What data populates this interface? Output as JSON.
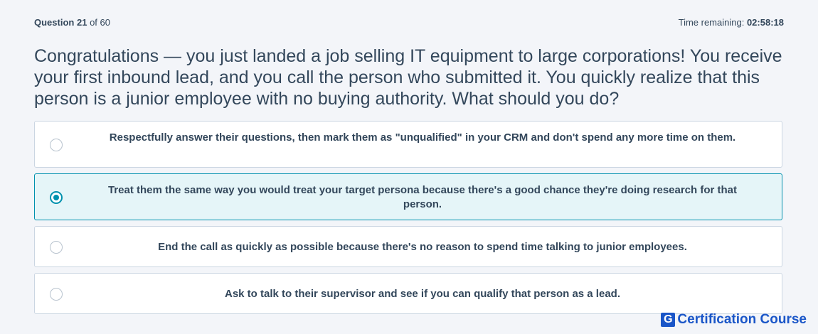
{
  "header": {
    "question_label": "Question",
    "question_number": "21",
    "question_of": "of 60",
    "time_label": "Time remaining:",
    "time_value": "02:58:18"
  },
  "question": {
    "text": "Congratulations — you just landed a job selling IT equipment to large corporations! You receive your first inbound lead, and you call the person who submitted it. You quickly realize that this person is a junior employee with no buying authority. What should you do?"
  },
  "options": [
    {
      "text": "Respectfully answer their questions, then mark them as \"unqualified\" in your CRM and don't spend any more time on them.",
      "selected": false
    },
    {
      "text": "Treat them the same way you would treat your target persona because there's a good chance they're doing research for that person.",
      "selected": true
    },
    {
      "text": "End the call as quickly as possible because there's no reason to spend time talking to junior employees.",
      "selected": false
    },
    {
      "text": "Ask to talk to their supervisor and see if you can qualify that person as a lead.",
      "selected": false
    }
  ],
  "watermark": {
    "logo_letter": "G",
    "text": "Certification Course"
  },
  "colors": {
    "background": "#f3f5f9",
    "text": "#33475b",
    "accent": "#0091ae",
    "selected_bg": "#e5f5f8",
    "watermark": "#1a56c8"
  }
}
